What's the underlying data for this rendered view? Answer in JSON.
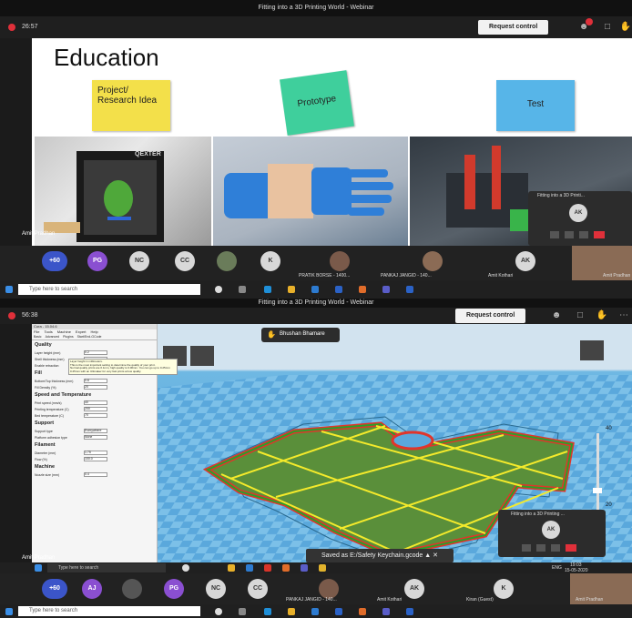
{
  "top": {
    "window_title": "Fitting into a 3D Printing World - Webinar",
    "timer": "26:57",
    "request_control": "Request control",
    "slide": {
      "title": "Education",
      "note1": "Project/ Research Idea",
      "note2": "Prototype",
      "note3": "Test",
      "printer_brand": "QEXTER"
    },
    "presenter_tag": "Amit Pradhan",
    "float_popup": {
      "title": "Fitting into a 3D Printi...",
      "avatar": "AK"
    },
    "participants": [
      {
        "label": "+60",
        "color": "#3b55c9"
      },
      {
        "label": "PG",
        "color": "#8a4fd1"
      },
      {
        "label": "NC",
        "color": "#d8d8d8"
      },
      {
        "label": "CC",
        "color": "#d8d8d8"
      },
      {
        "label": "K",
        "color": "#d8d8d8"
      }
    ],
    "video_names": [
      "PRATIK BORSE - 1400...",
      "PANKAJ JANGID - 140...",
      "Amit Kothari"
    ],
    "video_avatar": "AK",
    "video_last": "Amit Pradhan",
    "taskbar_search": "Type here to search"
  },
  "bottom": {
    "window_title": "Fitting into a 3D Printing World - Webinar",
    "timer": "56:38",
    "request_control": "Request control",
    "sharer": "Bhushan Bhamare",
    "cura": {
      "window_title": "Cura - 15.04.6",
      "menu": [
        "File",
        "Tools",
        "Machine",
        "Expert",
        "Help"
      ],
      "tabs": [
        "Basic",
        "Advanced",
        "Plugins",
        "Start/End-GCode"
      ],
      "sections": [
        {
          "title": "Quality",
          "fields": [
            [
              "Layer height (mm)",
              "0.2"
            ],
            [
              "Shell thickness (mm)",
              ""
            ],
            [
              "Enable retraction",
              ""
            ]
          ]
        },
        {
          "title": "Fill",
          "fields": [
            [
              "Bottom/Top thickness (mm)",
              "0.6"
            ],
            [
              "Fill Density (%)",
              "20"
            ]
          ]
        },
        {
          "title": "Speed and Temperature",
          "fields": [
            [
              "Print speed (mm/s)",
              "40"
            ],
            [
              "Printing temperature (C)",
              "200"
            ],
            [
              "Bed temperature (C)",
              "70"
            ]
          ]
        },
        {
          "title": "Support",
          "fields": [
            [
              "Support type",
              "Everywhere"
            ],
            [
              "Platform adhesion type",
              "None"
            ]
          ]
        },
        {
          "title": "Filament",
          "fields": [
            [
              "Diameter (mm)",
              "1.75"
            ],
            [
              "Flow (%)",
              "100.0"
            ]
          ]
        },
        {
          "title": "Machine",
          "fields": [
            [
              "Nozzle size (mm)",
              "0.4"
            ]
          ]
        }
      ],
      "tooltip": "Layer height in millimeters.\nThis is the most important setting to determine the quality of your print.\nNormal quality prints are 0.1mm, high quality is 0.06mm. You can go up to 0.25mm\n0.25mm with an Ultimaker for very fast prints at low quality.",
      "layer_top": "40",
      "layer_mid": "20"
    },
    "float_popup": {
      "title": "Fitting into a 3D Printing ...",
      "avatar": "AK"
    },
    "toast": "Saved as E:/Safety Keychain.gcode",
    "presenter_tag": "Amit Pradhan",
    "participants": [
      {
        "label": "+60",
        "color": "#3b55c9"
      },
      {
        "label": "AJ",
        "color": "#8a4fd1"
      },
      {
        "label": "PG",
        "color": "#8a4fd1"
      },
      {
        "label": "NC",
        "color": "#d8d8d8"
      },
      {
        "label": "CC",
        "color": "#d8d8d8"
      }
    ],
    "video_names": [
      "PANKAJ JANGID - 140...",
      "Amit Kothari",
      "Kiran (Guest)",
      "Amit Pradhan"
    ],
    "video_avatars": [
      "AK",
      "K"
    ],
    "taskbar_search": "Type here to search",
    "inner_taskbar_search": "Type here to search",
    "clock": "19:03",
    "date": "15-05-2020",
    "lang": "ENG"
  }
}
